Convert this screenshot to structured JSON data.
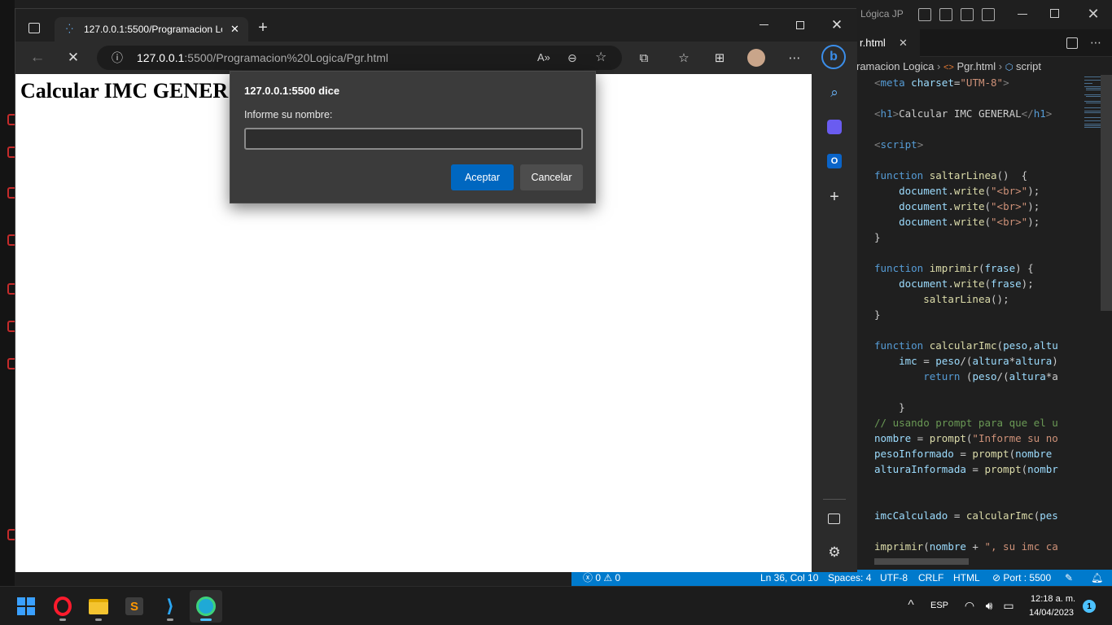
{
  "browser": {
    "tab_title": "127.0.0.1:5500/Programacion Lo",
    "address_host": "127.0.0.1",
    "address_rest": ":5500/Programacion%20Logica/Pgr.html",
    "page_heading": "Calcular IMC GENER"
  },
  "dialog": {
    "title": "127.0.0.1:5500 dice",
    "message": "Informe su nombre:",
    "input_value": "",
    "ok_label": "Aceptar",
    "cancel_label": "Cancelar"
  },
  "vscode": {
    "title_fragment": "Lógica JP",
    "tab_label": "r.html",
    "breadcrumb": {
      "folder": "ramacion Logica",
      "file": "Pgr.html",
      "symbol": "script"
    },
    "code_lines": [
      {
        "parts": [
          {
            "c": "tg",
            "t": "<"
          },
          {
            "c": "tn",
            "t": "meta "
          },
          {
            "c": "at",
            "t": "charset"
          },
          {
            "c": "",
            "t": "="
          },
          {
            "c": "st",
            "t": "\"UTM-8\""
          },
          {
            "c": "tg",
            "t": ">"
          }
        ]
      },
      {
        "parts": []
      },
      {
        "parts": [
          {
            "c": "tg",
            "t": "<"
          },
          {
            "c": "tn",
            "t": "h1"
          },
          {
            "c": "tg",
            "t": ">"
          },
          {
            "c": "",
            "t": "Calcular IMC GENERAL"
          },
          {
            "c": "tg",
            "t": "</"
          },
          {
            "c": "tn",
            "t": "h1"
          },
          {
            "c": "tg",
            "t": ">"
          }
        ]
      },
      {
        "parts": []
      },
      {
        "parts": [
          {
            "c": "tg",
            "t": "<"
          },
          {
            "c": "tn",
            "t": "script"
          },
          {
            "c": "tg",
            "t": ">"
          }
        ]
      },
      {
        "parts": []
      },
      {
        "parts": [
          {
            "c": "kw",
            "t": "function "
          },
          {
            "c": "fn",
            "t": "saltarLinea"
          },
          {
            "c": "",
            "t": "()  {"
          }
        ]
      },
      {
        "parts": [
          {
            "c": "",
            "t": "    "
          },
          {
            "c": "vr",
            "t": "document"
          },
          {
            "c": "",
            "t": "."
          },
          {
            "c": "fn",
            "t": "write"
          },
          {
            "c": "",
            "t": "("
          },
          {
            "c": "st",
            "t": "\"<br>\""
          },
          {
            "c": "",
            "t": ");"
          }
        ]
      },
      {
        "parts": [
          {
            "c": "",
            "t": "    "
          },
          {
            "c": "vr",
            "t": "document"
          },
          {
            "c": "",
            "t": "."
          },
          {
            "c": "fn",
            "t": "write"
          },
          {
            "c": "",
            "t": "("
          },
          {
            "c": "st",
            "t": "\"<br>\""
          },
          {
            "c": "",
            "t": ");"
          }
        ]
      },
      {
        "parts": [
          {
            "c": "",
            "t": "    "
          },
          {
            "c": "vr",
            "t": "document"
          },
          {
            "c": "",
            "t": "."
          },
          {
            "c": "fn",
            "t": "write"
          },
          {
            "c": "",
            "t": "("
          },
          {
            "c": "st",
            "t": "\"<br>\""
          },
          {
            "c": "",
            "t": ");"
          }
        ]
      },
      {
        "parts": [
          {
            "c": "",
            "t": "}"
          }
        ]
      },
      {
        "parts": []
      },
      {
        "parts": [
          {
            "c": "kw",
            "t": "function "
          },
          {
            "c": "fn",
            "t": "imprimir"
          },
          {
            "c": "",
            "t": "("
          },
          {
            "c": "vr",
            "t": "frase"
          },
          {
            "c": "",
            "t": ") {"
          }
        ]
      },
      {
        "parts": [
          {
            "c": "",
            "t": "    "
          },
          {
            "c": "vr",
            "t": "document"
          },
          {
            "c": "",
            "t": "."
          },
          {
            "c": "fn",
            "t": "write"
          },
          {
            "c": "",
            "t": "("
          },
          {
            "c": "vr",
            "t": "frase"
          },
          {
            "c": "",
            "t": ");"
          }
        ]
      },
      {
        "parts": [
          {
            "c": "",
            "t": "        "
          },
          {
            "c": "fn",
            "t": "saltarLinea"
          },
          {
            "c": "",
            "t": "();"
          }
        ]
      },
      {
        "parts": [
          {
            "c": "",
            "t": "}"
          }
        ]
      },
      {
        "parts": []
      },
      {
        "parts": [
          {
            "c": "kw",
            "t": "function "
          },
          {
            "c": "fn",
            "t": "calcularImc"
          },
          {
            "c": "",
            "t": "("
          },
          {
            "c": "vr",
            "t": "peso"
          },
          {
            "c": "",
            "t": ","
          },
          {
            "c": "vr",
            "t": "altu"
          }
        ]
      },
      {
        "parts": [
          {
            "c": "",
            "t": "    "
          },
          {
            "c": "vr",
            "t": "imc"
          },
          {
            "c": "",
            "t": " = "
          },
          {
            "c": "vr",
            "t": "peso"
          },
          {
            "c": "",
            "t": "/("
          },
          {
            "c": "vr",
            "t": "altura"
          },
          {
            "c": "",
            "t": "*"
          },
          {
            "c": "vr",
            "t": "altura"
          },
          {
            "c": "",
            "t": ")"
          }
        ]
      },
      {
        "parts": [
          {
            "c": "",
            "t": "        "
          },
          {
            "c": "kw",
            "t": "return"
          },
          {
            "c": "",
            "t": " ("
          },
          {
            "c": "vr",
            "t": "peso"
          },
          {
            "c": "",
            "t": "/("
          },
          {
            "c": "vr",
            "t": "altura"
          },
          {
            "c": "",
            "t": "*a"
          }
        ]
      },
      {
        "parts": []
      },
      {
        "parts": [
          {
            "c": "",
            "t": "    }"
          }
        ]
      },
      {
        "parts": [
          {
            "c": "cm",
            "t": "// usando prompt para que el u"
          }
        ]
      },
      {
        "parts": [
          {
            "c": "vr",
            "t": "nombre"
          },
          {
            "c": "",
            "t": " = "
          },
          {
            "c": "fn",
            "t": "prompt"
          },
          {
            "c": "",
            "t": "("
          },
          {
            "c": "st",
            "t": "\"Informe su no"
          }
        ]
      },
      {
        "parts": [
          {
            "c": "vr",
            "t": "pesoInformado"
          },
          {
            "c": "",
            "t": " = "
          },
          {
            "c": "fn",
            "t": "prompt"
          },
          {
            "c": "",
            "t": "("
          },
          {
            "c": "vr",
            "t": "nombre"
          }
        ]
      },
      {
        "parts": [
          {
            "c": "vr",
            "t": "alturaInformada"
          },
          {
            "c": "",
            "t": " = "
          },
          {
            "c": "fn",
            "t": "prompt"
          },
          {
            "c": "",
            "t": "("
          },
          {
            "c": "vr",
            "t": "nombr"
          }
        ]
      },
      {
        "parts": []
      },
      {
        "parts": []
      },
      {
        "parts": [
          {
            "c": "vr",
            "t": "imcCalculado"
          },
          {
            "c": "",
            "t": " = "
          },
          {
            "c": "fn",
            "t": "calcularImc"
          },
          {
            "c": "",
            "t": "("
          },
          {
            "c": "vr",
            "t": "pes"
          }
        ]
      },
      {
        "parts": []
      },
      {
        "parts": [
          {
            "c": "fn",
            "t": "imprimir"
          },
          {
            "c": "",
            "t": "("
          },
          {
            "c": "vr",
            "t": "nombre"
          },
          {
            "c": "",
            "t": " + "
          },
          {
            "c": "st",
            "t": "\", su imc ca"
          }
        ]
      }
    ],
    "status": {
      "errors": "0",
      "warnings": "0",
      "position": "Ln 36, Col 10",
      "spaces": "Spaces: 4",
      "encoding": "UTF-8",
      "eol": "CRLF",
      "language": "HTML",
      "port": "Port : 5500"
    }
  },
  "taskbar": {
    "language": "ESP",
    "time": "12:18 a. m.",
    "date": "14/04/2023",
    "notification_count": "1"
  },
  "colors": {
    "accent_blue": "#0067c0",
    "vscode_status": "#007acc",
    "opera_red": "#ff1b2d"
  }
}
